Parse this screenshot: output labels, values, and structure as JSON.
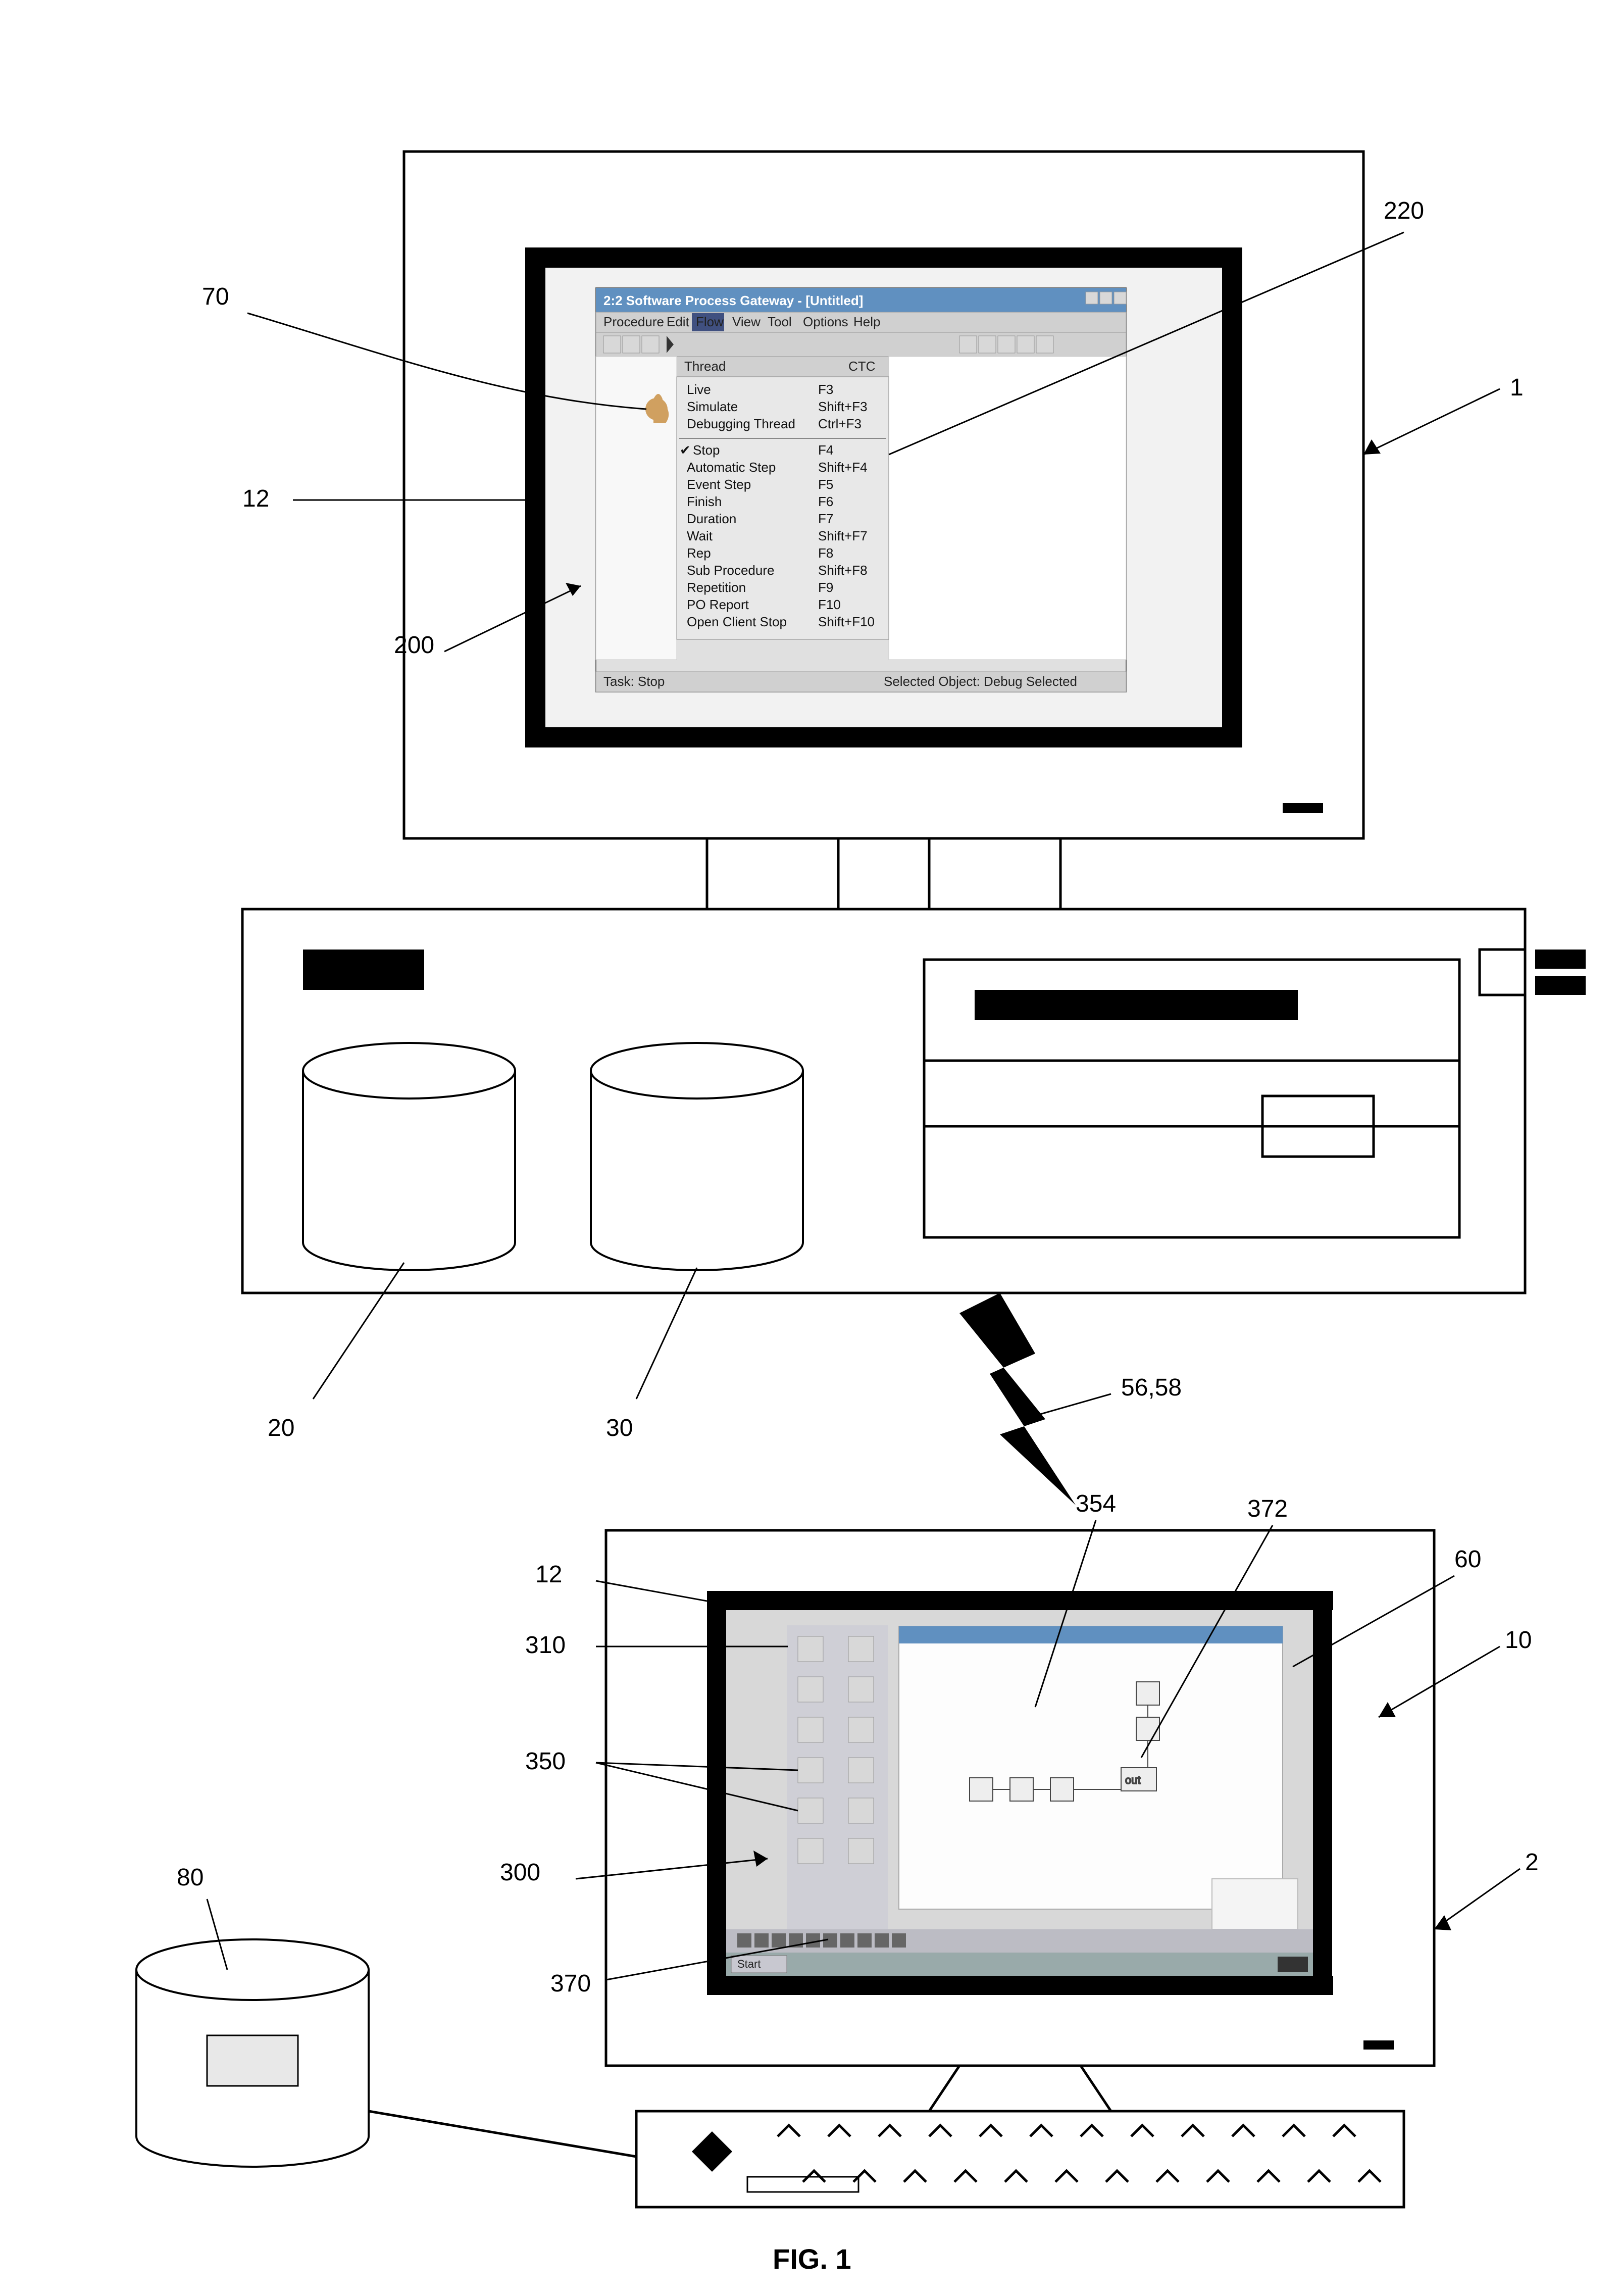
{
  "figure_label": "FIG. 1",
  "callouts": {
    "c1": "1",
    "c2": "2",
    "c10": "10",
    "c12a": "12",
    "c12b": "12",
    "c20": "20",
    "c30": "30",
    "c56_58": "56,58",
    "c60": "60",
    "c70": "70",
    "c80": "80",
    "c200": "200",
    "c220": "220",
    "c300": "300",
    "c310": "310",
    "c350": "350",
    "c354": "354",
    "c370": "370",
    "c372": "372"
  },
  "upper_window": {
    "title": "2:2 Software Process Gateway - [Untitled]",
    "menu": [
      "Procedure",
      "Edit",
      "Flow",
      "View",
      "Tool",
      "Options",
      "Help"
    ],
    "open_menu": {
      "header": {
        "label": "Thread",
        "shortcut": "CTC"
      },
      "items": [
        {
          "label": "Live",
          "shortcut": "F3"
        },
        {
          "label": "Simulate",
          "shortcut": "Shift+F3"
        },
        {
          "label": "Debugging Thread",
          "shortcut": "Ctrl+F3"
        },
        {
          "separator": true
        },
        {
          "label": "Stop",
          "shortcut": "F4",
          "checked": true
        },
        {
          "label": "Automatic Step",
          "shortcut": "Shift+F4"
        },
        {
          "label": "Event Step",
          "shortcut": "F5"
        },
        {
          "label": "Finish",
          "shortcut": "F6"
        },
        {
          "label": "Duration",
          "shortcut": "F7"
        },
        {
          "label": "Wait",
          "shortcut": "Shift+F7"
        },
        {
          "label": "Rep",
          "shortcut": "F8"
        },
        {
          "label": "Sub Procedure",
          "shortcut": "Shift+F8"
        },
        {
          "label": "Repetition",
          "shortcut": "F9"
        },
        {
          "label": "PO Report",
          "shortcut": "F10"
        },
        {
          "label": "Open Client Stop",
          "shortcut": "Shift+F10"
        }
      ]
    },
    "status_left": "Task: Stop",
    "status_right": "Selected Object: Debug Selected"
  },
  "lower_window": {
    "title": "",
    "taskbar_items": [
      "Start"
    ],
    "desktop_icons_count": 12,
    "app_open": true
  }
}
